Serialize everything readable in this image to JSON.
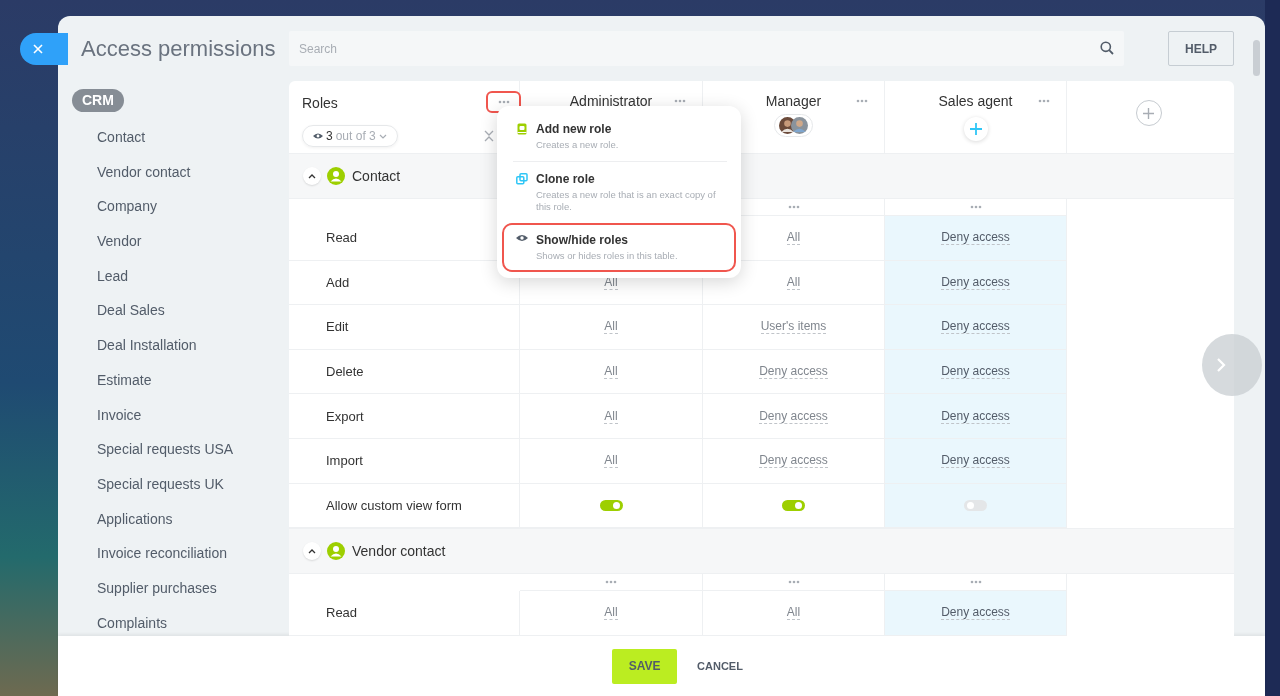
{
  "window": {
    "title": "Access permissions"
  },
  "search": {
    "placeholder": "Search"
  },
  "help_button": {
    "label": "HELP"
  },
  "sidebar": {
    "group_label": "CRM",
    "items": [
      {
        "label": "Contact",
        "selected": false
      },
      {
        "label": "Vendor contact",
        "selected": false
      },
      {
        "label": "Company",
        "selected": false
      },
      {
        "label": "Vendor",
        "selected": false
      },
      {
        "label": "Lead",
        "selected": false
      },
      {
        "label": "Deal Sales",
        "selected": false
      },
      {
        "label": "Deal Installation",
        "selected": false
      },
      {
        "label": "Estimate",
        "selected": false
      },
      {
        "label": "Invoice",
        "selected": false
      },
      {
        "label": "Special requests USA",
        "selected": false
      },
      {
        "label": "Special requests UK",
        "selected": false
      },
      {
        "label": "Applications",
        "selected": false
      },
      {
        "label": "Invoice reconciliation",
        "selected": false
      },
      {
        "label": "Supplier purchases",
        "selected": false
      },
      {
        "label": "Complaints",
        "selected": false
      }
    ]
  },
  "table": {
    "roles_header": {
      "label": "Roles",
      "menu_highlighted": true,
      "filter_count": "3",
      "filter_text": "out of 3"
    },
    "roles": [
      {
        "name": "Administrator",
        "kind": "plain",
        "highlighted": false
      },
      {
        "name": "Manager",
        "kind": "avatars",
        "highlighted": false
      },
      {
        "name": "Sales agent",
        "kind": "add",
        "highlighted": true
      }
    ],
    "sections": [
      {
        "title": "Contact",
        "expanded": true,
        "dots": [
          false,
          true,
          true
        ],
        "rows": [
          {
            "label": "Read",
            "kind": "value",
            "cells": [
              null,
              "All",
              "Deny access"
            ]
          },
          {
            "label": "Add",
            "kind": "value",
            "cells": [
              "All",
              "All",
              "Deny access"
            ]
          },
          {
            "label": "Edit",
            "kind": "value",
            "cells": [
              "All",
              "User's items",
              "Deny access"
            ]
          },
          {
            "label": "Delete",
            "kind": "value",
            "cells": [
              "All",
              "Deny access",
              "Deny access"
            ]
          },
          {
            "label": "Export",
            "kind": "value",
            "cells": [
              "All",
              "Deny access",
              "Deny access"
            ]
          },
          {
            "label": "Import",
            "kind": "value",
            "cells": [
              "All",
              "Deny access",
              "Deny access"
            ]
          },
          {
            "label": "Allow custom view form",
            "kind": "toggle",
            "cells": [
              true,
              true,
              false
            ]
          }
        ]
      },
      {
        "title": "Vendor contact",
        "expanded": true,
        "dots": [
          true,
          true,
          true
        ],
        "rows": [
          {
            "label": "Read",
            "kind": "value",
            "cells": [
              "All",
              "All",
              "Deny access"
            ]
          }
        ]
      }
    ]
  },
  "role_menu": {
    "items": [
      {
        "kind": "add",
        "title": "Add new role",
        "description": "Creates a new role.",
        "highlighted": false
      },
      {
        "kind": "clone",
        "title": "Clone role",
        "description": "Creates a new role that is an exact copy of this role.",
        "highlighted": false
      },
      {
        "kind": "visibility",
        "title": "Show/hide roles",
        "description": "Shows or hides roles in this table.",
        "highlighted": true
      }
    ]
  },
  "footer": {
    "save": "SAVE",
    "cancel": "CANCEL"
  }
}
